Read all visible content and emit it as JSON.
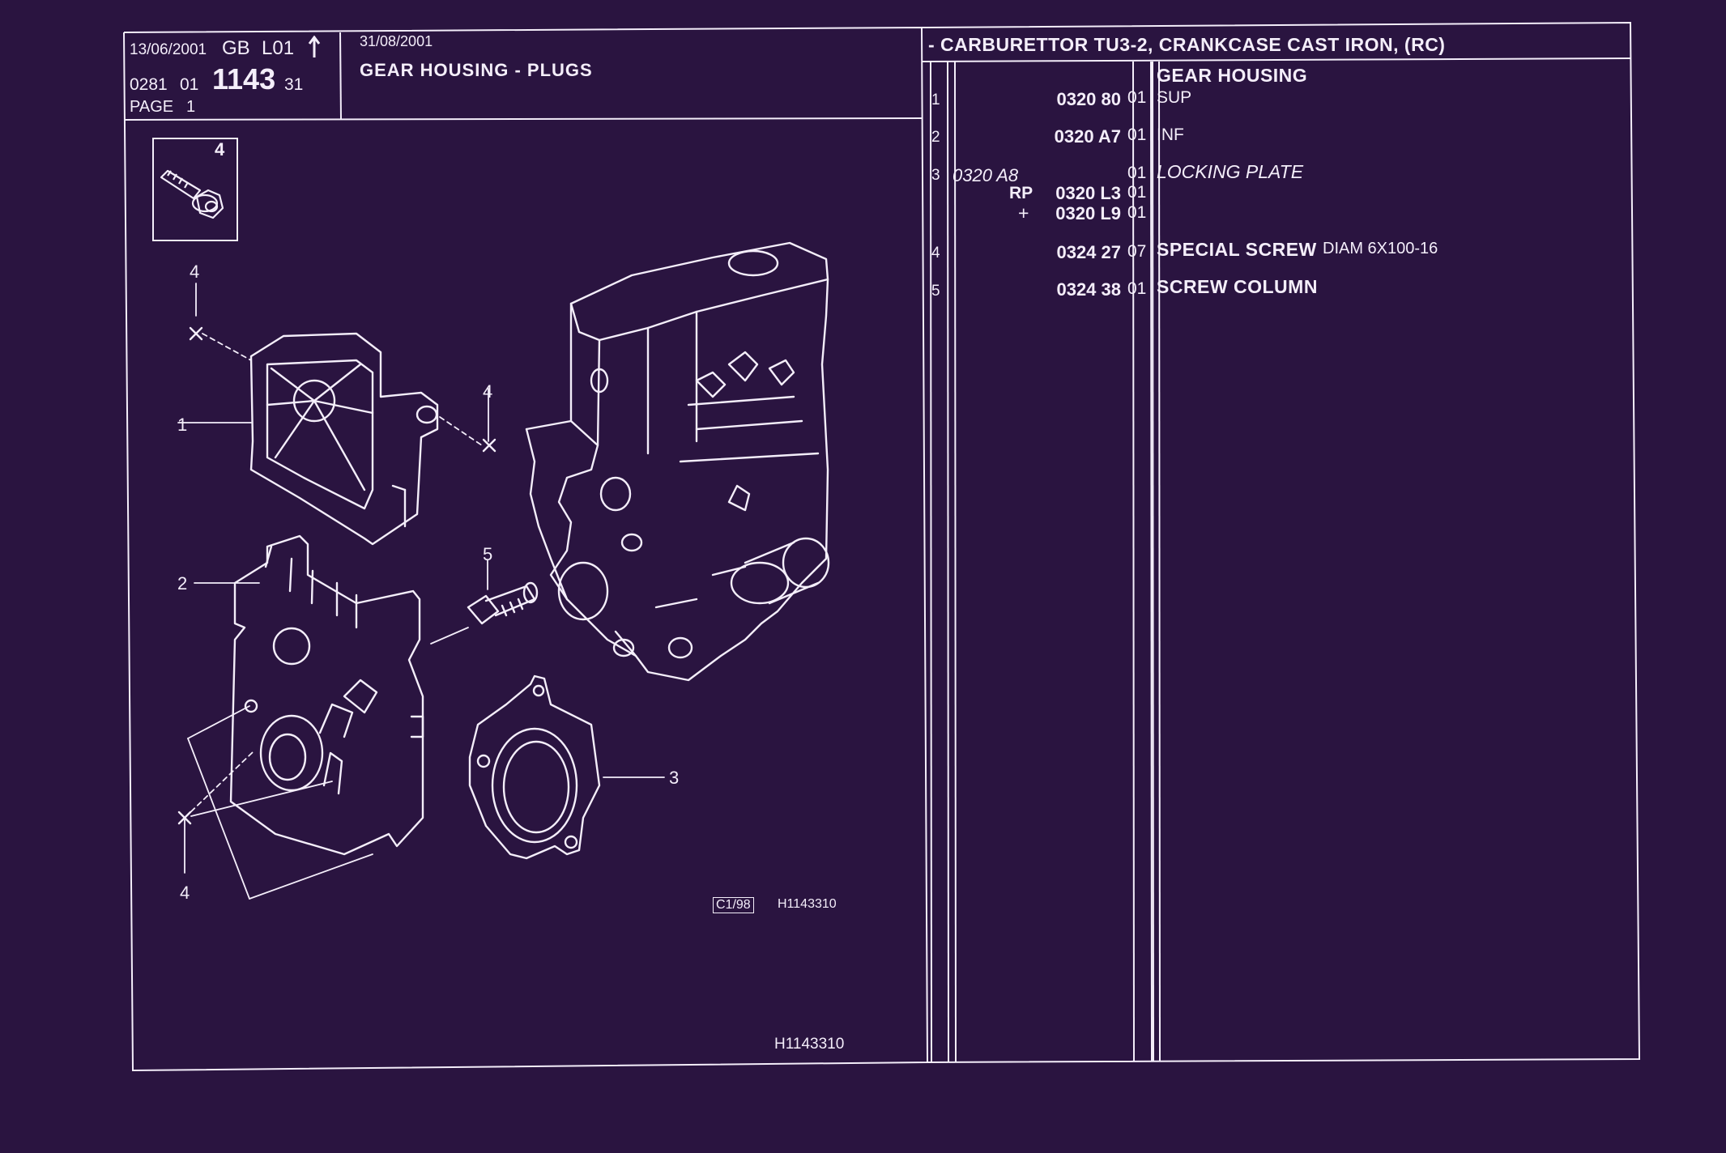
{
  "header": {
    "date": "13/06/2001",
    "lang": "GB",
    "level": "L01",
    "arrow_icon": "up-arrow-icon",
    "code_prefix": "0281",
    "code_sub": "01",
    "code_main": "1143",
    "code_suffix": "31",
    "page_label": "PAGE",
    "page_number": "1",
    "update_date": "31/08/2001",
    "section_title": "GEAR HOUSING - PLUGS",
    "vehicle_title": "- CARBURETTOR TU3-2, CRANKCASE CAST IRON, (RC)"
  },
  "inset": {
    "label": "4",
    "icon": "screw-icon"
  },
  "diagram": {
    "callouts": {
      "c4a": "4",
      "c4b": "4",
      "c1": "1",
      "c2": "2",
      "c5": "5",
      "c3": "3",
      "c4c": "4"
    },
    "ref_code": "C1/98",
    "ref_image": "H1143310"
  },
  "footer_ref": "H1143310",
  "parts": [
    {
      "idx": "1",
      "left_ref": "",
      "prefix": "",
      "ref": "0320 80",
      "qty": "01",
      "name": "GEAR HOUSING",
      "desc": "SUP"
    },
    {
      "idx": "2",
      "left_ref": "",
      "prefix": "",
      "ref": "0320 A7",
      "qty": "01",
      "name": "",
      "desc": "INF"
    },
    {
      "idx": "3",
      "left_ref": "0320 A8",
      "prefix": "",
      "ref": "",
      "qty": "01",
      "name": "",
      "desc": "LOCKING PLATE"
    },
    {
      "idx": "",
      "left_ref": "",
      "prefix": "RP",
      "ref": "0320 L3",
      "qty": "01",
      "name": "",
      "desc": ""
    },
    {
      "idx": "",
      "left_ref": "",
      "prefix": "+",
      "ref": "0320 L9",
      "qty": "01",
      "name": "",
      "desc": ""
    },
    {
      "idx": "4",
      "left_ref": "",
      "prefix": "",
      "ref": "0324 27",
      "qty": "07",
      "name": "SPECIAL SCREW",
      "desc": "DIAM 6X100-16"
    },
    {
      "idx": "5",
      "left_ref": "",
      "prefix": "",
      "ref": "0324 38",
      "qty": "01",
      "name": "SCREW COLUMN",
      "desc": ""
    }
  ],
  "colors": {
    "background": "#2a1440",
    "ink": "#f4eefa"
  }
}
